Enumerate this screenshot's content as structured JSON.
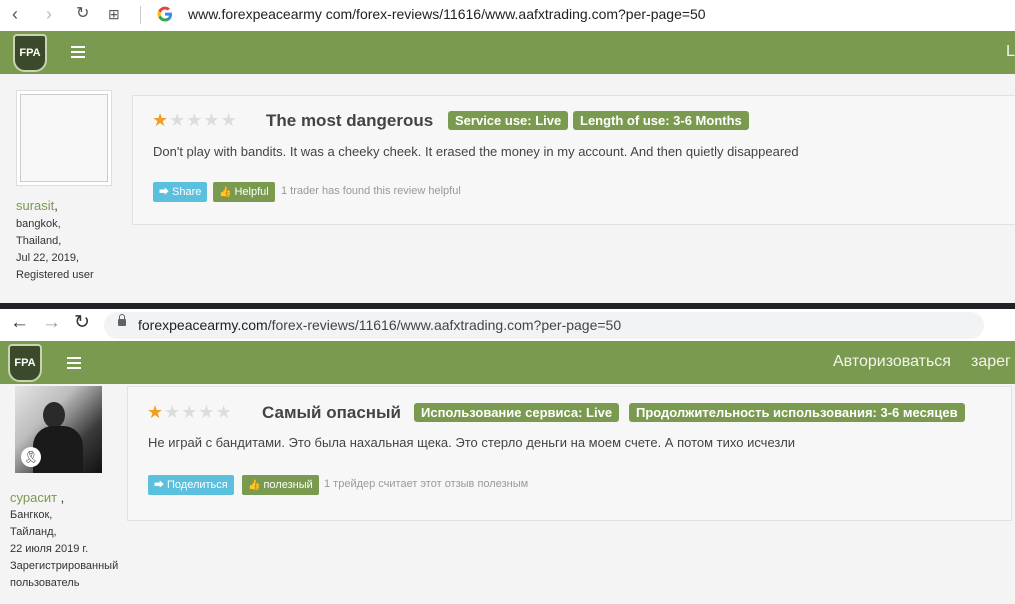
{
  "screenshot_en": {
    "browser": {
      "url": "www.forexpeacearmy com/forex-reviews/11616/www.aafxtrading.com?per-page=50"
    },
    "header": {
      "logo": "FPA",
      "right_link": "L"
    },
    "user": {
      "name": "surasit",
      "city": "bangkok,",
      "country": "Thailand,",
      "date": "Jul 22, 2019,",
      "status": "Registered user"
    },
    "review": {
      "rating": 1,
      "max_rating": 5,
      "title": "The most dangerous",
      "tag_service": "Service use: Live",
      "tag_length": "Length of use: 3-6 Months",
      "text": "Don't play with bandits. It was a cheeky cheek. It erased the money in my account. And then quietly disappeared",
      "share_label": "Share",
      "helpful_label": "Helpful",
      "helpful_note": "1 trader has found this review helpful"
    }
  },
  "screenshot_ru": {
    "browser": {
      "url_domain": "forexpeacearmy.com",
      "url_path": "/forex-reviews/11616/www.aafxtrading.com?per-page=50"
    },
    "header": {
      "logo": "FPA",
      "login": "Авторизоваться",
      "register": "зарег"
    },
    "user": {
      "name": "сурасит",
      "city": "Бангкок,",
      "country": "Тайланд,",
      "date": "22 июля 2019 г.",
      "status_line1": "Зарегистрированный",
      "status_line2": "пользователь"
    },
    "review": {
      "rating": 1,
      "max_rating": 5,
      "title": "Самый опасный",
      "tag_service": "Использование сервиса: Live",
      "tag_length": "Продолжительность использования: 3-6 месяцев",
      "text": "Не играй с бандитами. Это была нахальная щека. Это стерло деньги на моем счете. А потом тихо исчезли",
      "share_label": "Поделиться",
      "helpful_label": "полезный",
      "helpful_note": "1 трейдер считает этот отзыв полезным"
    }
  },
  "colors": {
    "brand_green": "#7a9a50",
    "share_blue": "#5bc0de",
    "star": "#f0a020"
  }
}
